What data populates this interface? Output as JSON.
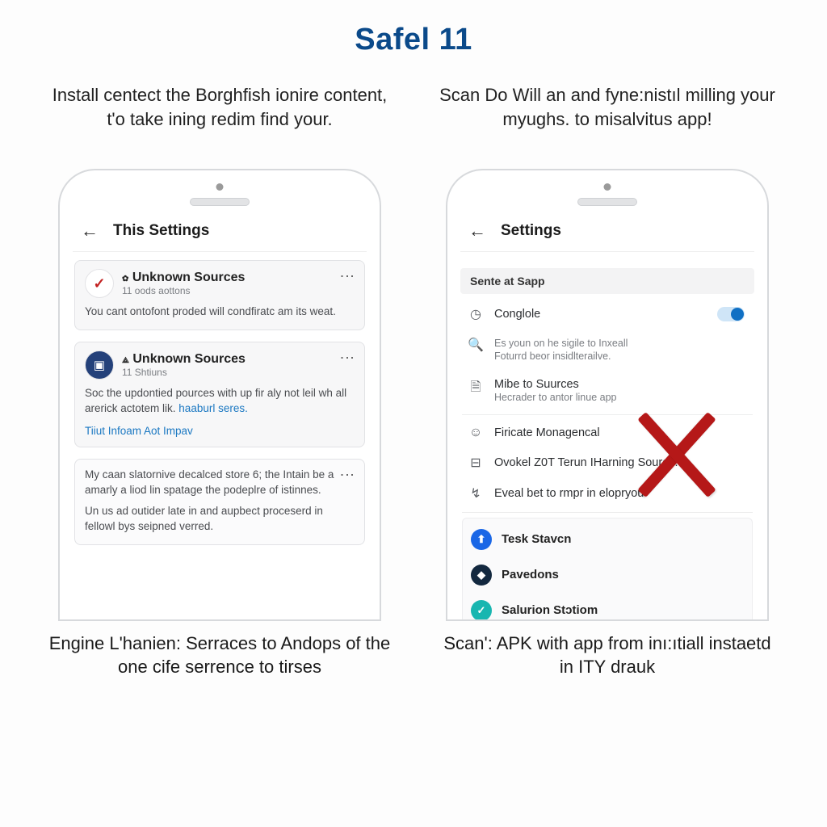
{
  "title": "Safel 11",
  "left": {
    "caption_top": "Install centect the Borghfish ionire content, t'o take ining redim find your.",
    "caption_bottom": "Engine L'hanien: Serraces to Andops of the one cife serrence to tirses",
    "header_title": "This Settings",
    "card1": {
      "title": "Unknown Sources",
      "sub": "11 oods aottons",
      "body": "You cant ontofont proded will condfiratc am its weat."
    },
    "card2": {
      "title": "Unknown Sources",
      "sub": "11 Shtiuns",
      "body": "Soc the updontied pources with up fir aly not leil wh all arerick actotem lik.",
      "body_link": "haaburl seres.",
      "footer_link": "Tiiut Infoam Aot Impav"
    },
    "card3": {
      "body1": "My caan slatornive decalced store 6; the Intain be a amarly a liod lin spatage the podeplre of istinnes.",
      "body2": "Un us ad outider late in and aupbect proceserd in fellowl bys seipned verred."
    }
  },
  "right": {
    "caption_top": "Scan Do Will an and fyne:nistıl milling your myughs. to misalvitus app!",
    "caption_bottom": "Scan': APK with app from inı:ıtiall instaetd in ITY drauk",
    "header_title": "Settings",
    "section": "Sente at Sapp",
    "rows": {
      "r1": "Conglole",
      "r2a": "Es youn on he sigile to Inxeall",
      "r2b": "Foturrd beor insidlterailve.",
      "r3": "Mibe to Suurces",
      "r3_link": "Hecrader to antor linue app",
      "r4": "Firicate Monagencal",
      "r5": "Ovokel Z0T Terun IHarning Source.",
      "r6": "Eveal bet to rmpr in elopryou"
    },
    "apps": {
      "a1": "Tesk Stavcn",
      "a2": "Pavedons",
      "a3": "Salurion Stɔtiom"
    }
  }
}
